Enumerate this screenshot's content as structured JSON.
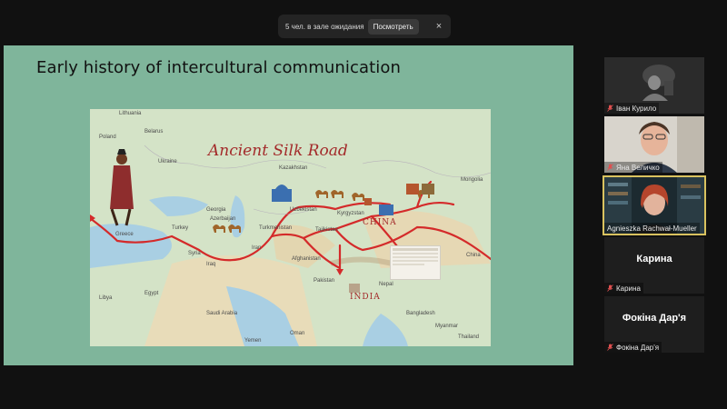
{
  "notification": {
    "text": "5 чел. в зале ожидания",
    "view_label": "Посмотреть",
    "close_glyph": "×"
  },
  "slide": {
    "title": "Early history of intercultural communication",
    "map": {
      "title": "Ancient Silk Road",
      "region_labels": [
        "CHINA",
        "INDIA"
      ],
      "place_labels": [
        "Lithuania",
        "Belarus",
        "Ukraine",
        "Poland",
        "Greece",
        "Turkey",
        "Syria",
        "Iraq",
        "Egypt",
        "Libya",
        "Saudi Arabia",
        "Georgia",
        "Azerbaijan",
        "Kazakhstan",
        "Uzbekistan",
        "Turkmenistan",
        "Kyrgyzstan",
        "Tajikistan",
        "Afghanistan",
        "Pakistan",
        "Mongolia",
        "Nepal",
        "Bangladesh",
        "Myanmar",
        "Thailand",
        "China",
        "Iran",
        "Oman",
        "Yemen"
      ]
    }
  },
  "participants": [
    {
      "name": "Іван Курило",
      "display": "video"
    },
    {
      "name": "Яна Величко",
      "display": "video"
    },
    {
      "name": "Agnieszka Rachwał-Mueller",
      "display": "video",
      "active": true
    },
    {
      "name": "Карина",
      "display": "name"
    },
    {
      "name": "Фокіна Дар'я",
      "display": "name"
    }
  ],
  "colors": {
    "background": "#111111",
    "slide_bg": "#7fb59b",
    "route": "#d42a2a",
    "active_speaker_border": "#d9c25f",
    "mic_muted": "#e05050"
  }
}
